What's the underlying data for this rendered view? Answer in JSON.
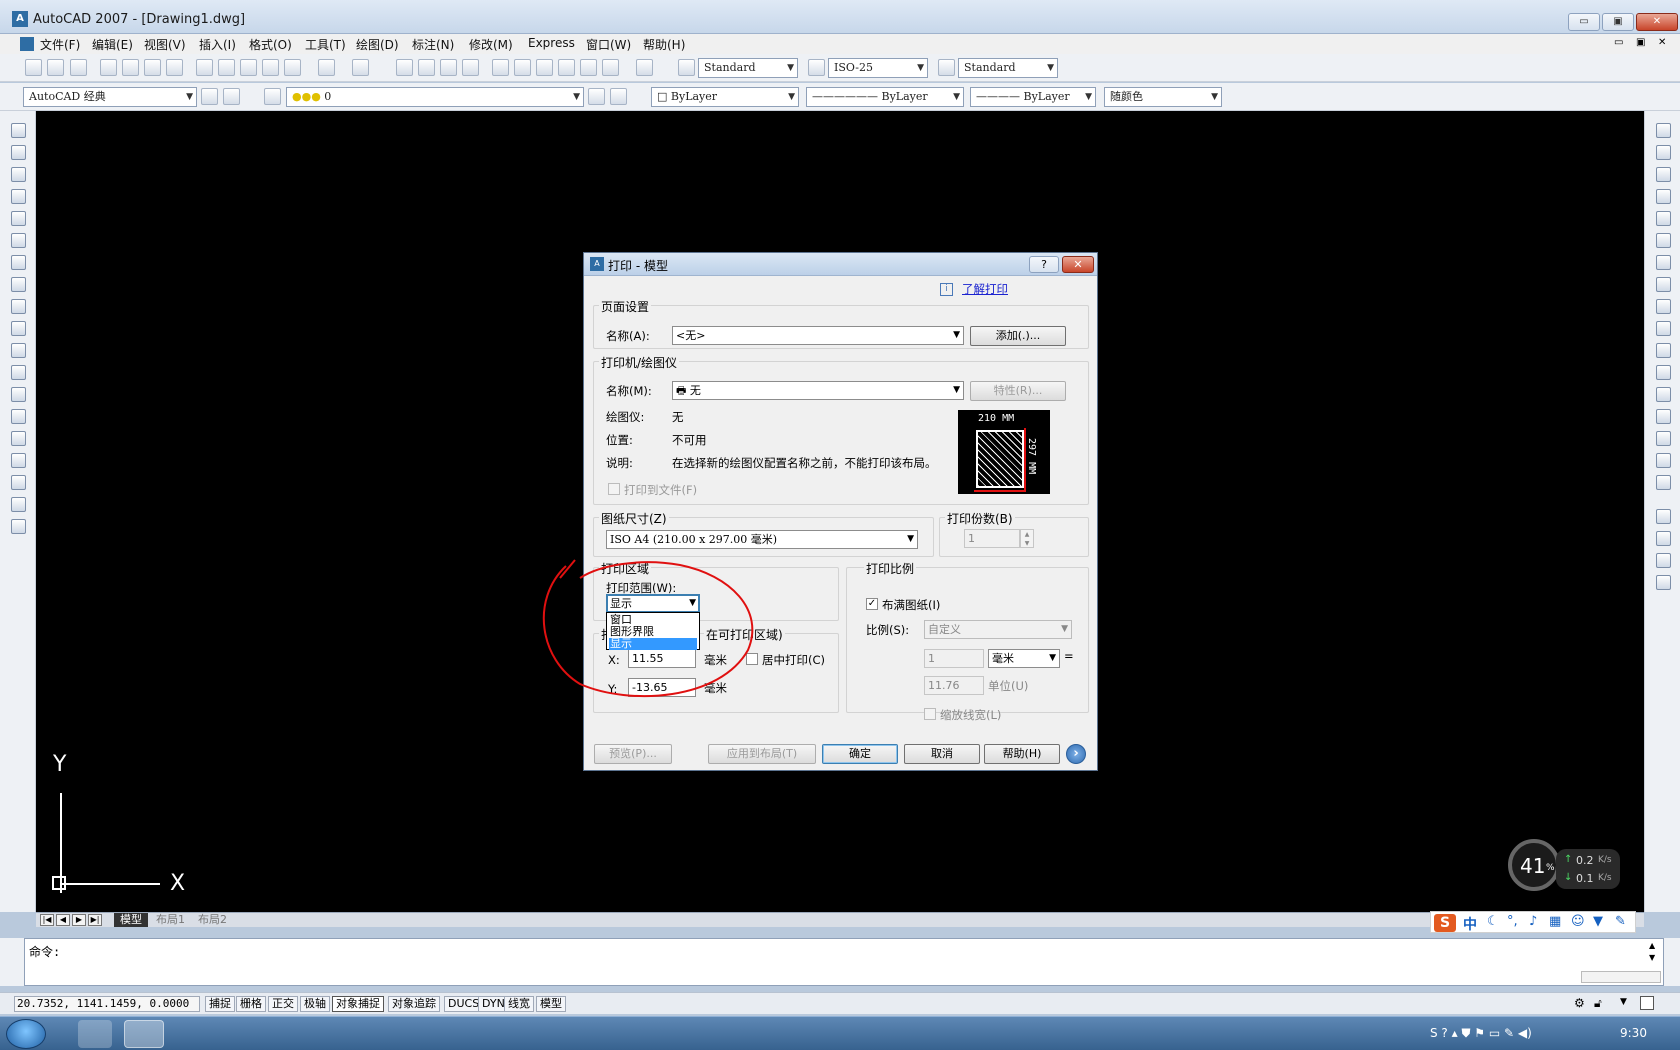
{
  "window": {
    "title": "AutoCAD 2007 - [Drawing1.dwg]",
    "minimize": "▭",
    "restore": "▣",
    "close": "✕"
  },
  "menu": [
    "文件(F)",
    "编辑(E)",
    "视图(V)",
    "插入(I)",
    "格式(O)",
    "工具(T)",
    "绘图(D)",
    "标注(N)",
    "修改(M)",
    "Express",
    "窗口(W)",
    "帮助(H)"
  ],
  "toolbar1": {
    "text_style": "Standard",
    "dim_style": "ISO-25",
    "table_style": "Standard"
  },
  "toolbar2": {
    "workspace": "AutoCAD 经典",
    "layer": "0",
    "color": "ByLayer",
    "linetype": "ByLayer",
    "lineweight": "ByLayer",
    "plotstyle": "随颜色"
  },
  "ucs": {
    "x": "X",
    "y": "Y"
  },
  "tabs": {
    "model": "模型",
    "layout1": "布局1",
    "layout2": "布局2"
  },
  "ime": {
    "logo": "S",
    "lang": "中"
  },
  "network": {
    "percent": "41",
    "unit": "%",
    "up": "0.2",
    "down": "0.1",
    "rate_unit": "K/s"
  },
  "command": {
    "prompt": "命令:"
  },
  "status": {
    "coords": "20.7352,  1141.1459, 0.0000",
    "buttons": [
      "捕捉",
      "栅格",
      "正交",
      "极轴",
      "对象捕捉",
      "对象追踪",
      "DUCS",
      "DYN",
      "线宽",
      "模型"
    ]
  },
  "taskbar": {
    "time": "9:30"
  },
  "dialog": {
    "title": "打印 - 模型",
    "help_btn": "?",
    "learn_link": "了解打印",
    "page_setup": {
      "title": "页面设置",
      "name_label": "名称(A):",
      "name_value": "<无>",
      "add_btn": "添加(.)..."
    },
    "printer": {
      "title": "打印机/绘图仪",
      "name_label": "名称(M):",
      "name_value": "无",
      "props_btn": "特性(R)...",
      "plotter_label": "绘图仪:",
      "plotter_value": "无",
      "location_label": "位置:",
      "location_value": "不可用",
      "desc_label": "说明:",
      "desc_value": "在选择新的绘图仪配置名称之前，不能打印该布局。",
      "to_file": "打印到文件(F)",
      "preview_w": "210 MM",
      "preview_h": "297 MM"
    },
    "paper_size": {
      "title": "图纸尺寸(Z)",
      "value": "ISO A4 (210.00 x 297.00 毫米)"
    },
    "copies": {
      "title": "打印份数(B)",
      "value": "1"
    },
    "plot_area": {
      "title": "打印区域",
      "range_label": "打印范围(W):",
      "selected": "显示",
      "options": [
        "窗口",
        "图形界限",
        "显示"
      ]
    },
    "offset": {
      "title_prefix": "打",
      "title_suffix": "在可打印区域)",
      "x_label": "X:",
      "x_value": "11.55",
      "y_label": "Y:",
      "y_value": "-13.65",
      "unit": "毫米",
      "center": "居中打印(C)"
    },
    "scale": {
      "title": "打印比例",
      "fit": "布满图纸(I)",
      "scale_label": "比例(S):",
      "scale_value": "自定义",
      "v1": "1",
      "unit": "毫米",
      "equals": "=",
      "v2": "11.76",
      "unit2": "单位(U)",
      "lineweights": "缩放线宽(L)"
    },
    "buttons": {
      "preview": "预览(P)...",
      "apply": "应用到布局(T)",
      "ok": "确定",
      "cancel": "取消",
      "help": "帮助(H)",
      "more": "›"
    }
  }
}
